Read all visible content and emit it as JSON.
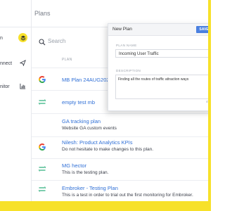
{
  "sidebar": {
    "items": [
      {
        "label": "n",
        "icon": "layers-icon",
        "active": true
      },
      {
        "label": "nnect",
        "icon": "send-icon",
        "active": false
      },
      {
        "label": "nitor",
        "icon": "bar-chart-icon",
        "active": false
      }
    ]
  },
  "header": {
    "title": "Plans"
  },
  "search": {
    "placeholder": "Search"
  },
  "table": {
    "plan_column": "PLAN",
    "rows": [
      {
        "name": "MB Plan 24AUG2022",
        "desc": "",
        "logo": "google-icon"
      },
      {
        "name": "empty test mb",
        "desc": "",
        "logo": "segment-icon"
      },
      {
        "name": "GA tracking plan",
        "desc": "Website GA custom events",
        "logo": ""
      },
      {
        "name": "Nilesh: Product Analytics KPIs",
        "desc": "Do not hesitate to make changes to this plan.",
        "logo": "google-icon"
      },
      {
        "name": "MG hector",
        "desc": "This is the testing plan.",
        "logo": "segment-icon"
      },
      {
        "name": "Embroker - Testing Plan",
        "desc": "This is a test in order to trial out the first monitoring for Embroker.",
        "logo": "segment-icon"
      }
    ]
  },
  "modal": {
    "title": "New Plan",
    "save_label": "SAVE",
    "plan_name_label": "PLAN NAME",
    "plan_name_value": "Incoming User Traffic",
    "description_label": "DESCRIPTION",
    "description_value": "Finding all the routes of traffic attraction ways",
    "char_count": "49"
  },
  "colors": {
    "accent": "#f7e12a",
    "link": "#2f6fd6",
    "save": "#4a80e0"
  }
}
